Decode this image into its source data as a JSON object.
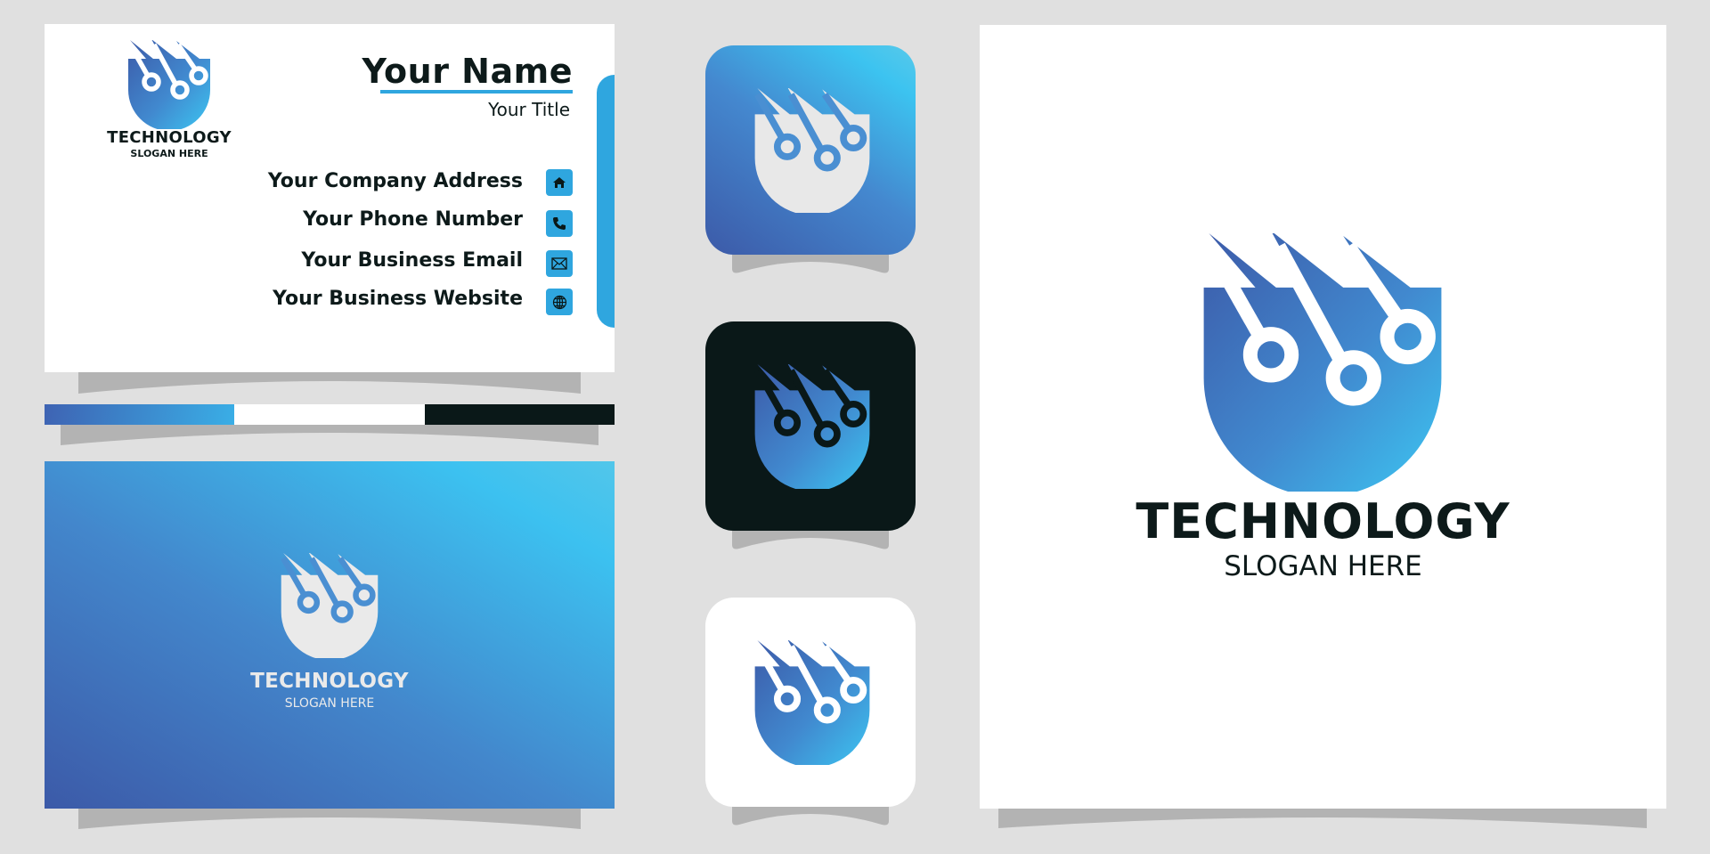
{
  "brand": {
    "name": "TECHNOLOGY",
    "slogan": "SLOGAN HERE"
  },
  "business_card": {
    "name": "Your Name",
    "title": "Your Title",
    "contacts": [
      {
        "label": "Your Company Address",
        "icon": "home-icon"
      },
      {
        "label": "Your Phone Number",
        "icon": "phone-icon"
      },
      {
        "label": "Your Business Email",
        "icon": "mail-icon"
      },
      {
        "label": "Your Business Website",
        "icon": "globe-icon"
      }
    ]
  },
  "palette": {
    "gradient_start": "#3c5aa8",
    "gradient_end": "#3cc3f0",
    "accent_blue": "#2fa6df",
    "white": "#ffffff",
    "black": "#0a1818",
    "text_dark": "#0d1a1a",
    "background": "#e0e0e0"
  },
  "app_icons": [
    {
      "variant": "blue-background"
    },
    {
      "variant": "dark-background"
    },
    {
      "variant": "white-background"
    }
  ]
}
